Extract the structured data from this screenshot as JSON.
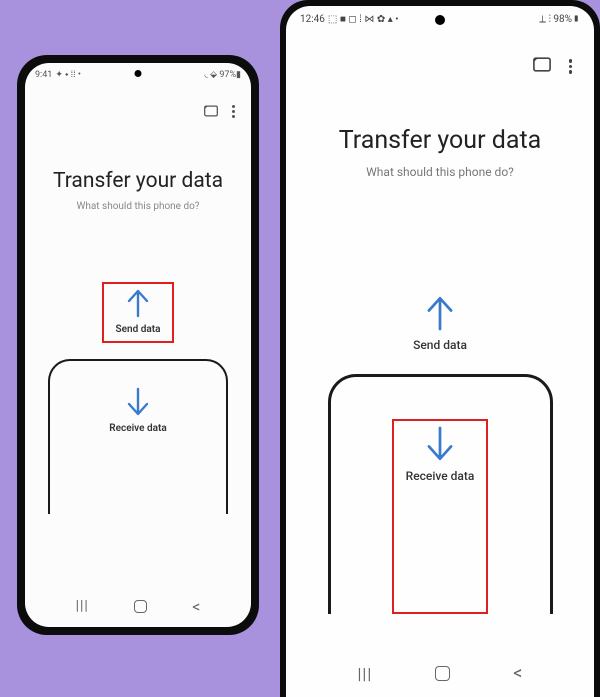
{
  "left": {
    "status": {
      "time": "9:41",
      "icons": "✦ ⬩ ⁞⁞ •",
      "right": "◟ ⬙ 97%▮"
    },
    "title": "Transfer your data",
    "subtitle": "What should this phone do?",
    "send_label": "Send data",
    "receive_label": "Receive data"
  },
  "right": {
    "status": {
      "time": "12:46",
      "icons": "⬚ ■ ◻ ⁞ ⋈ ✿ ▴ •",
      "right": "⟂ ⫶ 98%▮"
    },
    "title": "Transfer your data",
    "subtitle": "What should this phone do?",
    "send_label": "Send data",
    "receive_label": "Receive data"
  },
  "colors": {
    "arrow": "#3a7acb",
    "highlight": "#e02020"
  }
}
